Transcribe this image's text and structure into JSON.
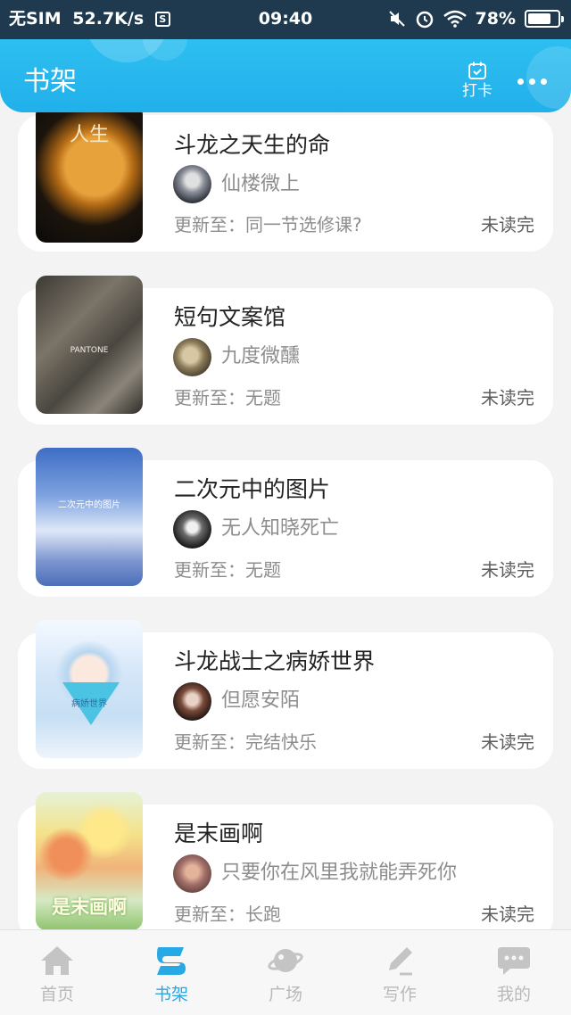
{
  "status_bar": {
    "carrier": "无SIM",
    "net_speed": "52.7K/s",
    "s_icon": "S",
    "time": "09:40",
    "battery": "78%",
    "battery_level": 0.78,
    "icons": [
      "mute-icon",
      "alarm-icon",
      "wifi-icon",
      "battery-icon"
    ]
  },
  "header": {
    "title": "书架",
    "checkin_label": "打卡",
    "checkin_icon": "calendar-check-icon",
    "more_icon": "more-dots-icon",
    "gradient": [
      "#33c8f4",
      "#21b0ea"
    ]
  },
  "books": [
    {
      "title": "斗龙之天生的命",
      "author": "仙楼微上",
      "update": "更新至：同一节选修课?",
      "status": "未读完",
      "cover_text": "人生"
    },
    {
      "title": "短句文案馆",
      "author": "九度微醺",
      "update": "更新至：无题",
      "status": "未读完",
      "cover_text": "PANTONE"
    },
    {
      "title": "二次元中的图片",
      "author": "无人知晓死亡",
      "update": "更新至：无题",
      "status": "未读完",
      "cover_text": "二次元中的图片"
    },
    {
      "title": "斗龙战士之病娇世界",
      "author": "但愿安陌",
      "update": "更新至：完结快乐",
      "status": "未读完",
      "cover_text": "病娇世界"
    },
    {
      "title": "是末画啊",
      "author": "只要你在风里我就能弄死你",
      "update": "更新至：长跑",
      "status": "未读完",
      "cover_text": "是末画啊"
    }
  ],
  "nav": {
    "items": [
      {
        "label": "首页",
        "icon": "home-icon",
        "active": false
      },
      {
        "label": "书架",
        "icon": "bookshelf-icon",
        "active": true
      },
      {
        "label": "广场",
        "icon": "planet-icon",
        "active": false
      },
      {
        "label": "写作",
        "icon": "pen-icon",
        "active": false
      },
      {
        "label": "我的",
        "icon": "chat-bubble-icon",
        "active": false
      }
    ],
    "active_color": "#26a9e5",
    "inactive_color": "#b9b9b9"
  }
}
